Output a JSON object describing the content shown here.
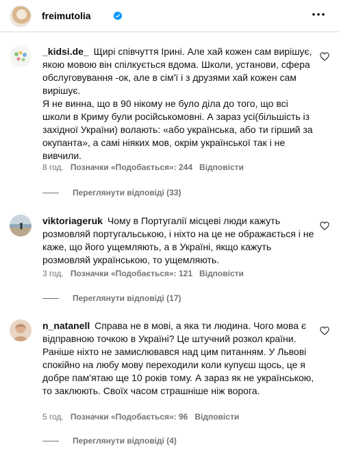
{
  "header": {
    "username": "freimutolia",
    "verified_icon": "verified-badge-icon",
    "more_icon": "more-horizontal-icon"
  },
  "comments": [
    {
      "username": "_kidsi.de_",
      "text": "Щирі співчуття Ірині. Але хай кожен сам вирішує, якою мовою він спілкується вдома. Школи, установи, сфера обслуговування -ок, але в сім'ї і з друзями хай кожен сам вирішує.\nЯ не винна, що в 90 нікому не було діла до того, що всі школи в Криму були російськомовні. А зараз усі(більшість із західної України) волають: «або українська, або ти гірший за окупанта», а самі ніяких мов, окрім української так і не вивчили.",
      "time": "8 год.",
      "likes": "Позначки «Подобається»: 244",
      "reply": "Відповісти",
      "view_replies": "Переглянути відповіді (33)"
    },
    {
      "username": "viktoriageruk",
      "text": "Чому в Португалії місцеві люди кажуть розмовляй португальською, і ніхто на це не ображається і не каже, що його ущемляють, а в Україні, якщо кажуть розмовляй українською, то ущемляють.",
      "time": "3 год.",
      "likes": "Позначки «Подобається»: 121",
      "reply": "Відповісти",
      "view_replies": "Переглянути відповіді (17)"
    },
    {
      "username": "n_natanell",
      "text": "Справа не в мові, а яка ти людина. Чого мова є відправною точкою в Україні? Це штучний розкол країни. Раніше ніхто не замислювався над цим питанням. У Львові спокійно на любу мову переходили коли купуєш щось, це я добре пам'ятаю ще 10 років тому. А зараз як не українською, то заклюють. Своїх часом страшніше ніж ворога.",
      "time": "5 год.",
      "likes": "Позначки «Подобається»: 96",
      "reply": "Відповісти",
      "view_replies": "Переглянути відповіді (4)"
    }
  ]
}
